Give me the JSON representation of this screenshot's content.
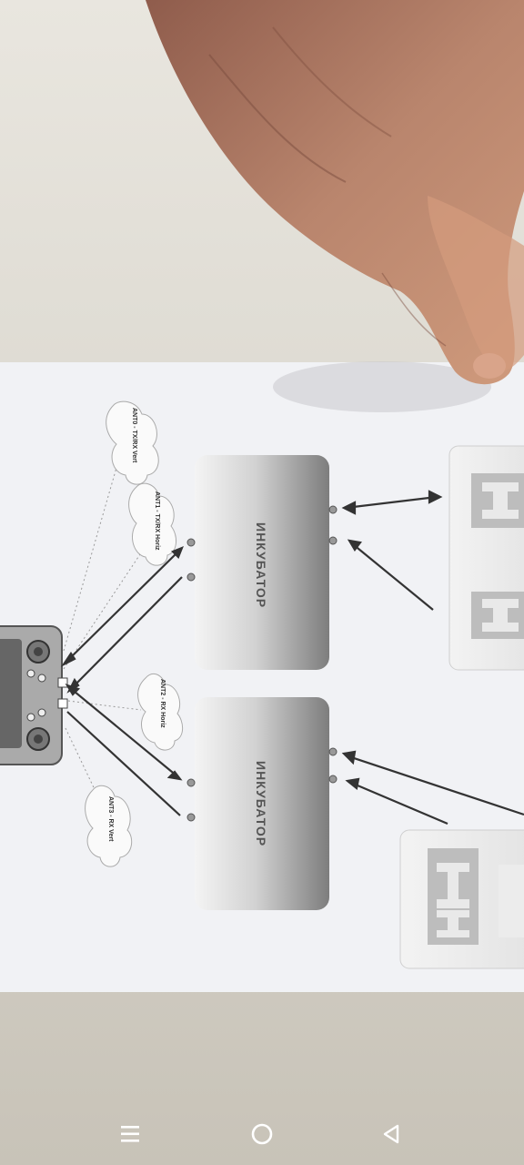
{
  "photo": {
    "incubator_labels": [
      "ИНКУБАТОР",
      "ИНКУБАТОР"
    ],
    "antenna_labels": [
      "ANT0 - TX/RX Vert",
      "ANT1 - TX/RX Horiz",
      "ANT2 - RX Horiz",
      "ANT3 - RX Vert"
    ]
  },
  "navbar": {
    "menu_icon": "menu-icon",
    "home_icon": "home-circle-icon",
    "back_icon": "back-triangle-icon"
  },
  "colors": {
    "table": "#d8d4c9",
    "paper": "#f2f3f6",
    "box_dark": "#8c8c8c",
    "box_light": "#e2e2e2",
    "skin": "#b57f68",
    "navbar_icon": "#ffffff"
  }
}
